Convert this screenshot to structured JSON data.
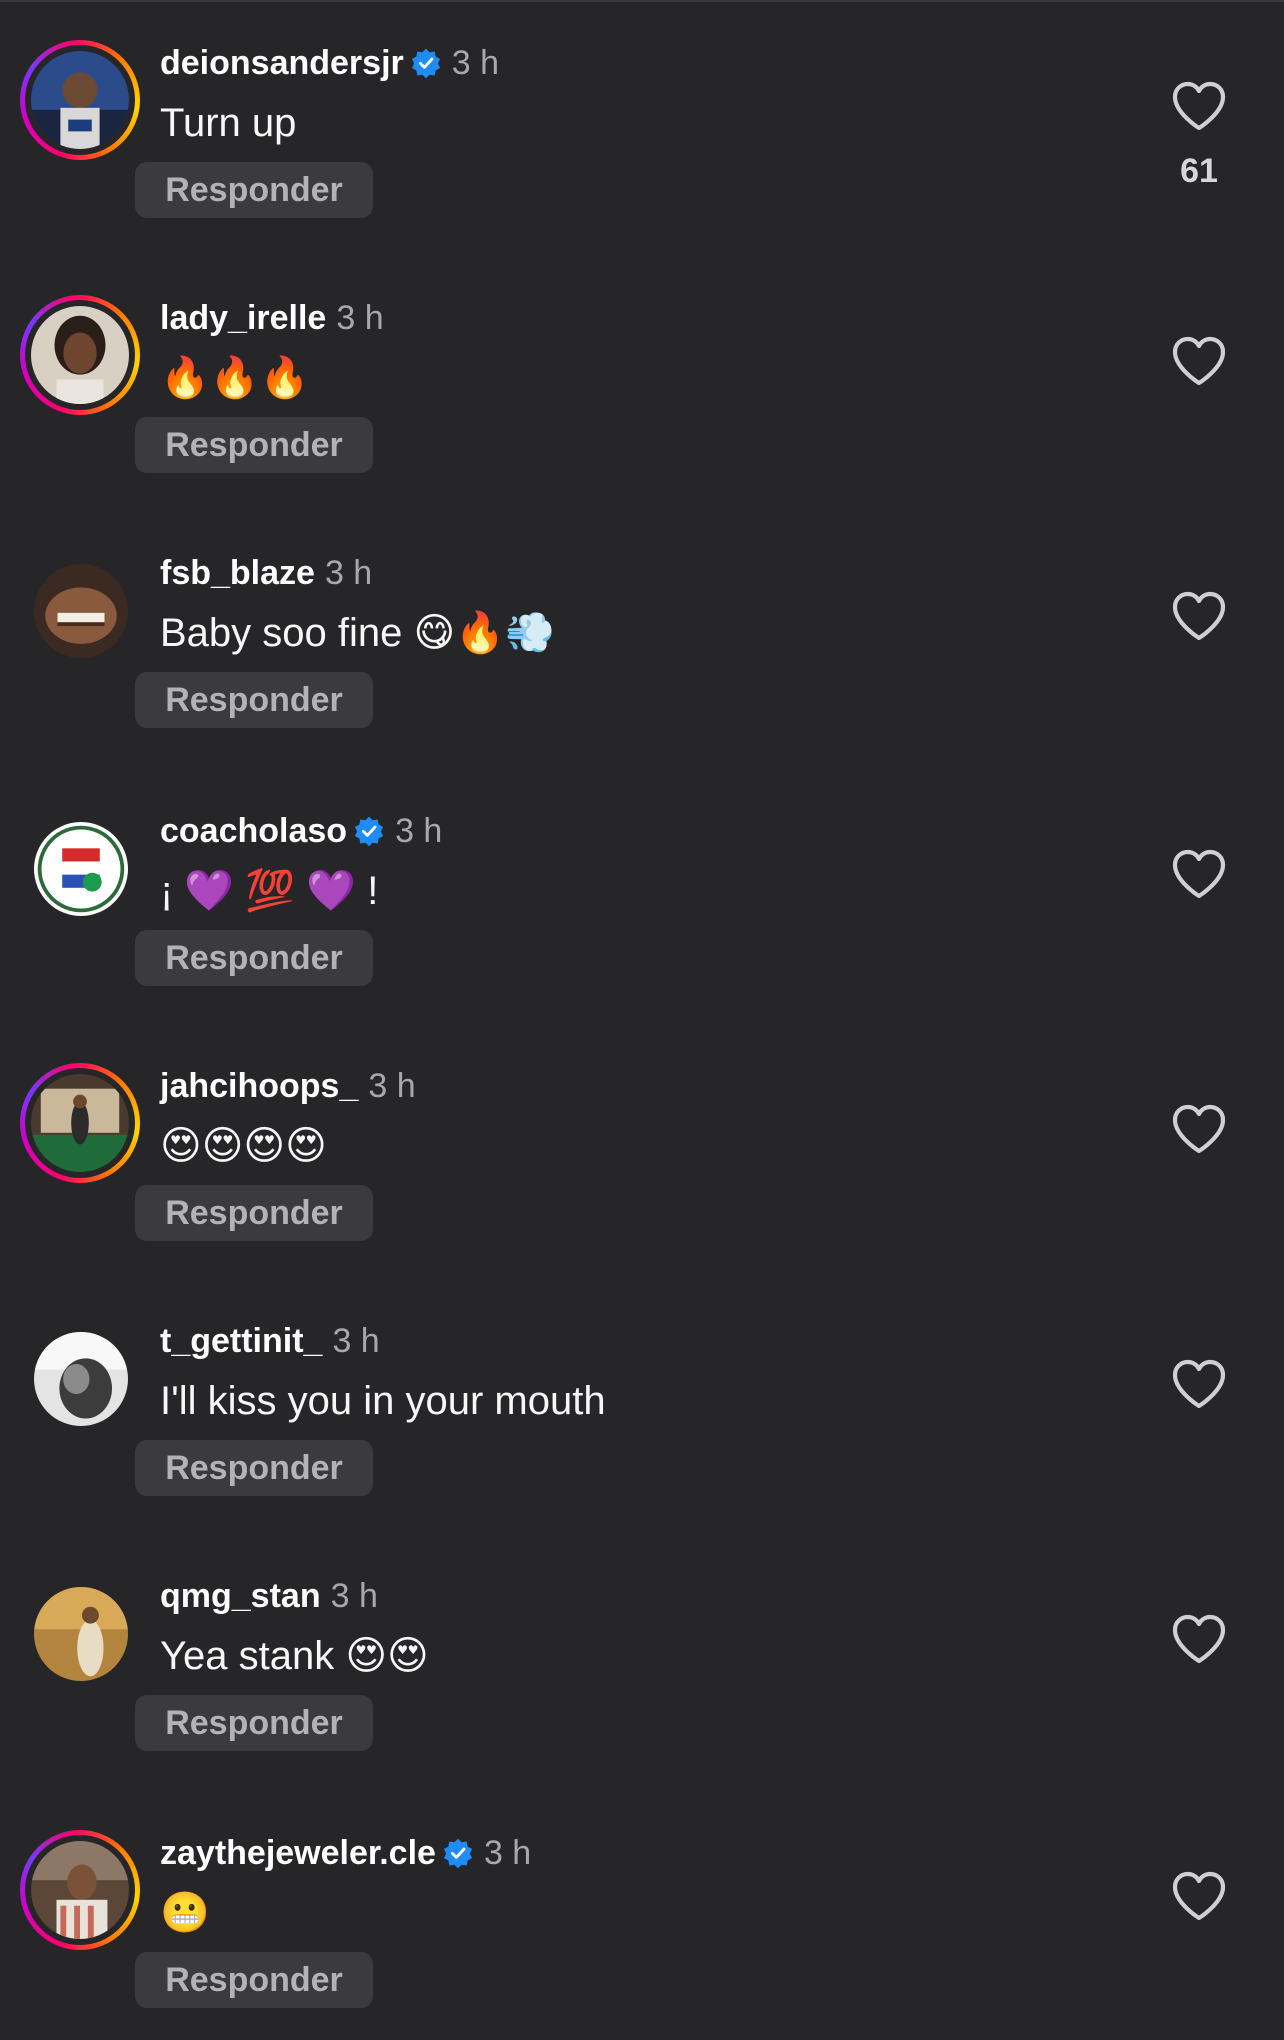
{
  "comments": [
    {
      "username": "deionsandersjr",
      "verified": true,
      "time": "3 h",
      "text": "Turn up",
      "reply_label": "Responder",
      "likes": "61",
      "story": true
    },
    {
      "username": "lady_irelle",
      "verified": false,
      "time": "3 h",
      "text": "🔥🔥🔥",
      "reply_label": "Responder",
      "likes": "",
      "story": true
    },
    {
      "username": "fsb_blaze",
      "verified": false,
      "time": "3 h",
      "text": "Baby soo fine 😋🔥💨",
      "reply_label": "Responder",
      "likes": "",
      "story": false
    },
    {
      "username": "coacholaso",
      "verified": true,
      "time": "3 h",
      "text": "¡ 💜 💯 💜 !",
      "reply_label": "Responder",
      "likes": "",
      "story": false
    },
    {
      "username": "jahcihoops_",
      "verified": false,
      "time": "3 h",
      "text": "😍😍😍😍",
      "reply_label": "Responder",
      "likes": "",
      "story": true
    },
    {
      "username": "t_gettinit_",
      "verified": false,
      "time": "3 h",
      "text": "I'll kiss you in your mouth",
      "reply_label": "Responder",
      "likes": "",
      "story": false
    },
    {
      "username": "qmg_stan",
      "verified": false,
      "time": "3 h",
      "text": "Yea stank 😍😍",
      "reply_label": "Responder",
      "likes": "",
      "story": false
    },
    {
      "username": "zaythejeweler.cle",
      "verified": true,
      "time": "3 h",
      "text": "😬",
      "reply_label": "Responder",
      "likes": "",
      "story": true
    }
  ],
  "icons": {
    "like": "heart-outline-icon",
    "verified": "verified-badge-icon"
  },
  "colors": {
    "background": "#262628",
    "verified": "#1f8cf5",
    "reply_button": "#3b3b3e",
    "muted_text": "#a8a8ab"
  }
}
